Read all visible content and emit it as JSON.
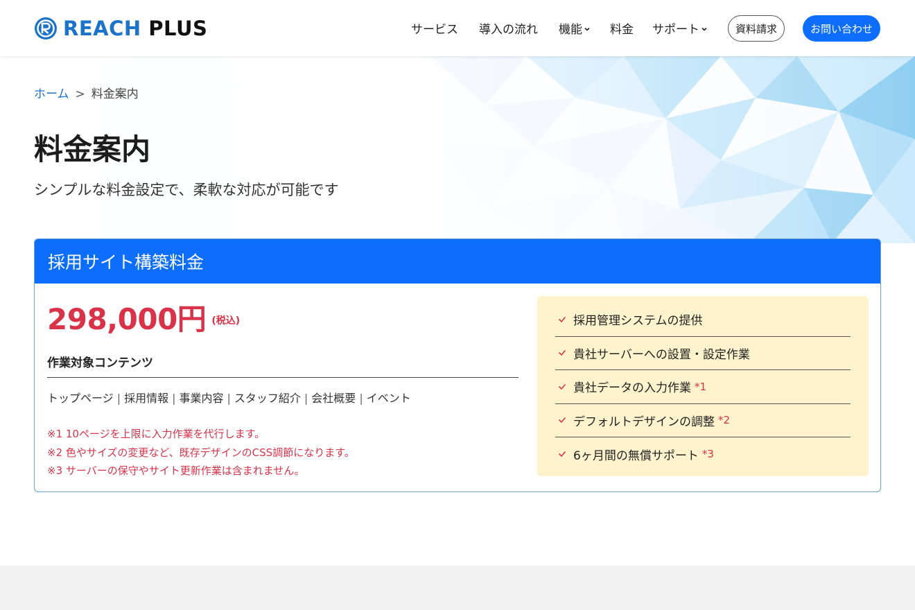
{
  "brand": {
    "name_part1": "REACH",
    "name_part2": "PLUS",
    "primary_color": "#0d6efd",
    "logo_blue": "#1a73c8",
    "price_red": "#d9334a",
    "feature_bg": "#fff3cd"
  },
  "nav": {
    "items": [
      {
        "label": "サービス"
      },
      {
        "label": "導入の流れ"
      },
      {
        "label": "機能"
      },
      {
        "label": "料金"
      },
      {
        "label": "サポート"
      }
    ],
    "request_docs": "資料請求",
    "contact": "お問い合わせ"
  },
  "breadcrumb": {
    "home": "ホーム",
    "separator": ">",
    "current": "料金案内"
  },
  "page": {
    "title": "料金案内",
    "subtitle": "シンプルな料金設定で、柔軟な対応が可能です"
  },
  "plan": {
    "title": "採用サイト構築料金",
    "price": "298,000円",
    "tax_note": "(税込)",
    "contents_heading": "作業対象コンテンツ",
    "contents": [
      "トップページ",
      "採用情報",
      "事業内容",
      "スタッフ紹介",
      "会社概要",
      "イベント"
    ],
    "content_separator": "|",
    "notes": [
      "※1 10ページを上限に入力作業を代行します。",
      "※2 色やサイズの変更など、既存デザインのCSS調節になります。",
      "※3 サーバーの保守やサイト更新作業は含まれません。"
    ],
    "features": [
      {
        "text": "採用管理システムの提供",
        "mark": ""
      },
      {
        "text": "貴社サーバーへの設置・設定作業",
        "mark": ""
      },
      {
        "text": "貴社データの入力作業",
        "mark": "*1"
      },
      {
        "text": "デフォルトデザインの調整",
        "mark": "*2"
      },
      {
        "text": "6ヶ月間の無償サポート",
        "mark": "*3"
      }
    ]
  }
}
